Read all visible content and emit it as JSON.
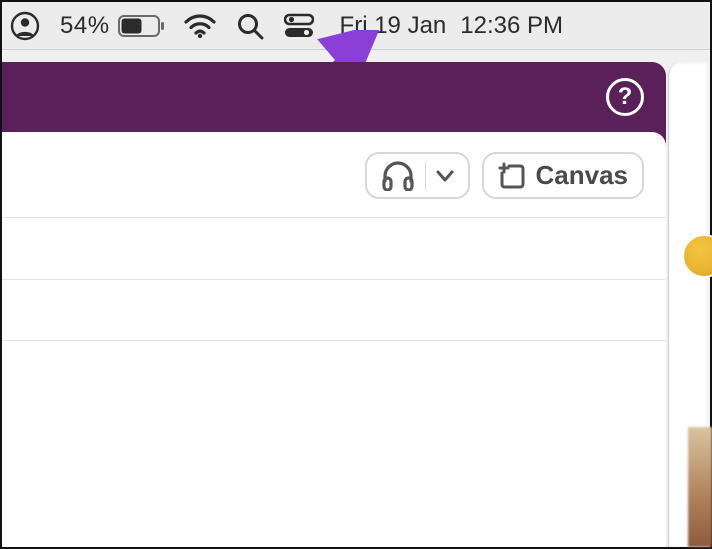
{
  "menubar": {
    "battery_pct": "54%",
    "date": "Fri 19 Jan",
    "time": "12:36 PM"
  },
  "app": {
    "help_tooltip": "?",
    "toolbar": {
      "canvas_label": "Canvas"
    }
  }
}
